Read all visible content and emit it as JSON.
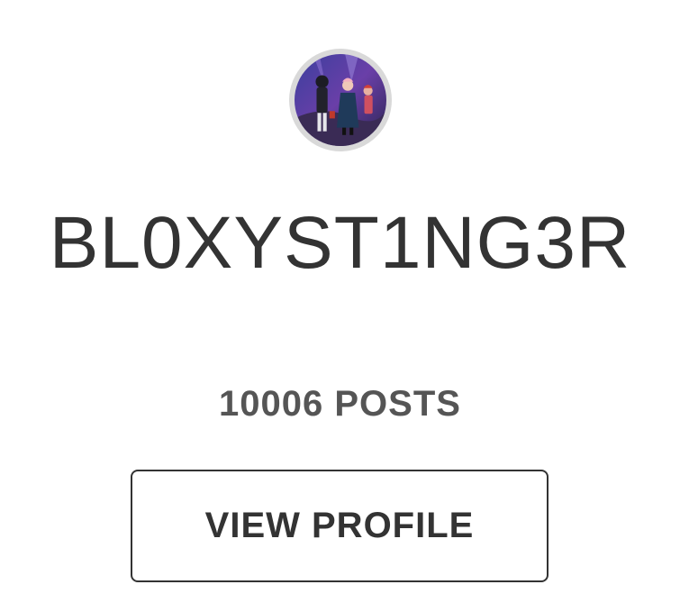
{
  "profile": {
    "username": "BL0XYST1NG3R",
    "post_count": "10006 POSTS",
    "view_profile_label": "VIEW PROFILE",
    "avatar_icon": "user-avatar-image"
  },
  "colors": {
    "text_primary": "#333333",
    "text_secondary": "#555555",
    "avatar_border": "#d9d9d9",
    "background": "#ffffff"
  }
}
